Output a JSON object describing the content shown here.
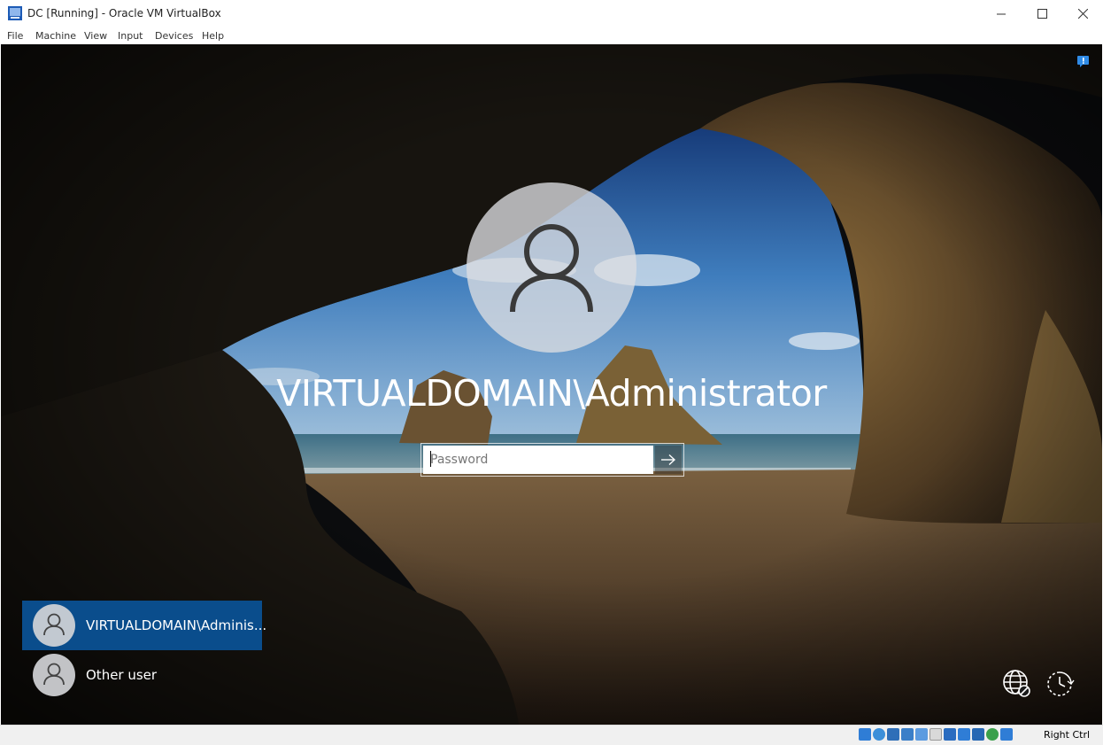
{
  "window": {
    "title": "DC [Running] - Oracle VM VirtualBox",
    "menu": [
      "File",
      "Machine",
      "View",
      "Input",
      "Devices",
      "Help"
    ]
  },
  "login": {
    "username": "VIRTUALDOMAIN\\Administrator",
    "password_placeholder": "Password"
  },
  "user_list": [
    {
      "label": "VIRTUALDOMAIN\\Adminis...",
      "selected": true
    },
    {
      "label": "Other user",
      "selected": false
    }
  ],
  "corner_buttons": [
    "network-icon",
    "ease-of-access-icon"
  ],
  "statusbar": {
    "icons": [
      "hard-disk-icon",
      "optical-drive-icon",
      "audio-icon",
      "network-adapter-icon",
      "usb-icon",
      "shared-folders-icon",
      "display-icon",
      "recording-icon",
      "cpu-icon",
      "mouse-integration-icon",
      "keyboard-icon"
    ],
    "host_key": "Right Ctrl"
  },
  "colors": {
    "selected_tile": "#0a4d8c",
    "titlebar": "#ffffff"
  }
}
